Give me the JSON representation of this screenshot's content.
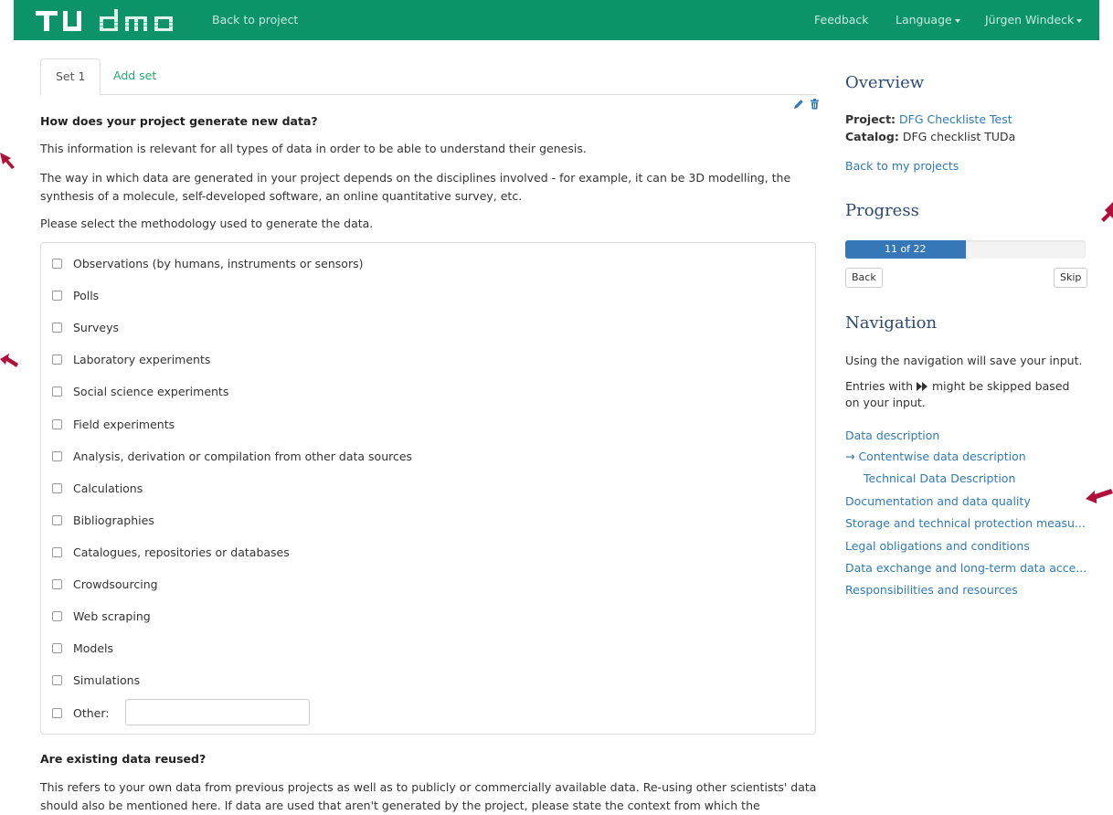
{
  "header": {
    "logo_text": "TU dmo",
    "back_to_project": "Back to project",
    "feedback": "Feedback",
    "language": "Language",
    "user": "Jürgen Windeck"
  },
  "tabs": {
    "set1": "Set 1",
    "add_set": "Add set"
  },
  "question1": {
    "title": "How does your project generate new data?",
    "p1": "This information is relevant for all types of data in order to be able to understand their genesis.",
    "p2": "The way in which data are generated in your project depends on the disciplines involved - for example, it can be 3D modelling, the synthesis of a molecule, self-developed software, an online quantitative survey, etc.",
    "p3": "Please select the methodology used to generate the data.",
    "options": [
      "Observations (by humans, instruments or sensors)",
      "Polls",
      "Surveys",
      "Laboratory experiments",
      "Social science experiments",
      "Field experiments",
      "Analysis, derivation or compilation from other data sources",
      "Calculations",
      "Bibliographies",
      "Catalogues, repositories or databases",
      "Crowdsourcing",
      "Web scraping",
      "Models",
      "Simulations"
    ],
    "other_label": "Other:",
    "other_value": ""
  },
  "question2": {
    "title": "Are existing data reused?",
    "p1": "This refers to your own data from previous projects as well as to publicly or commercially available data. Re-using other scientists' data should also be mentioned here. If data are used that aren't generated by the project, please state the context from which the"
  },
  "overview": {
    "heading": "Overview",
    "project_label": "Project:",
    "project_name": "DFG Checkliste Test",
    "catalog_label": "Catalog:",
    "catalog_name": "DFG checklist TUDa",
    "back_link": "Back to my projects"
  },
  "progress": {
    "heading": "Progress",
    "text": "11 of 22",
    "current": 11,
    "total": 22,
    "back": "Back",
    "skip": "Skip"
  },
  "navigation": {
    "heading": "Navigation",
    "note1": "Using the navigation will save your input.",
    "note2_a": "Entries with",
    "note2_b": "might be skipped based",
    "note2_c": "on your input.",
    "items": [
      "Data description",
      "→ Contentwise data description",
      "Technical Data Description",
      "Documentation and data quality",
      "Storage and technical protection measu...",
      "Legal obligations and conditions",
      "Data exchange and long-term data acce...",
      "Responsibilities and resources"
    ]
  },
  "colors": {
    "header_bg": "#0c9369",
    "link": "#2f7ab8",
    "progress": "#3677b7",
    "arrow": "#b0103a"
  }
}
